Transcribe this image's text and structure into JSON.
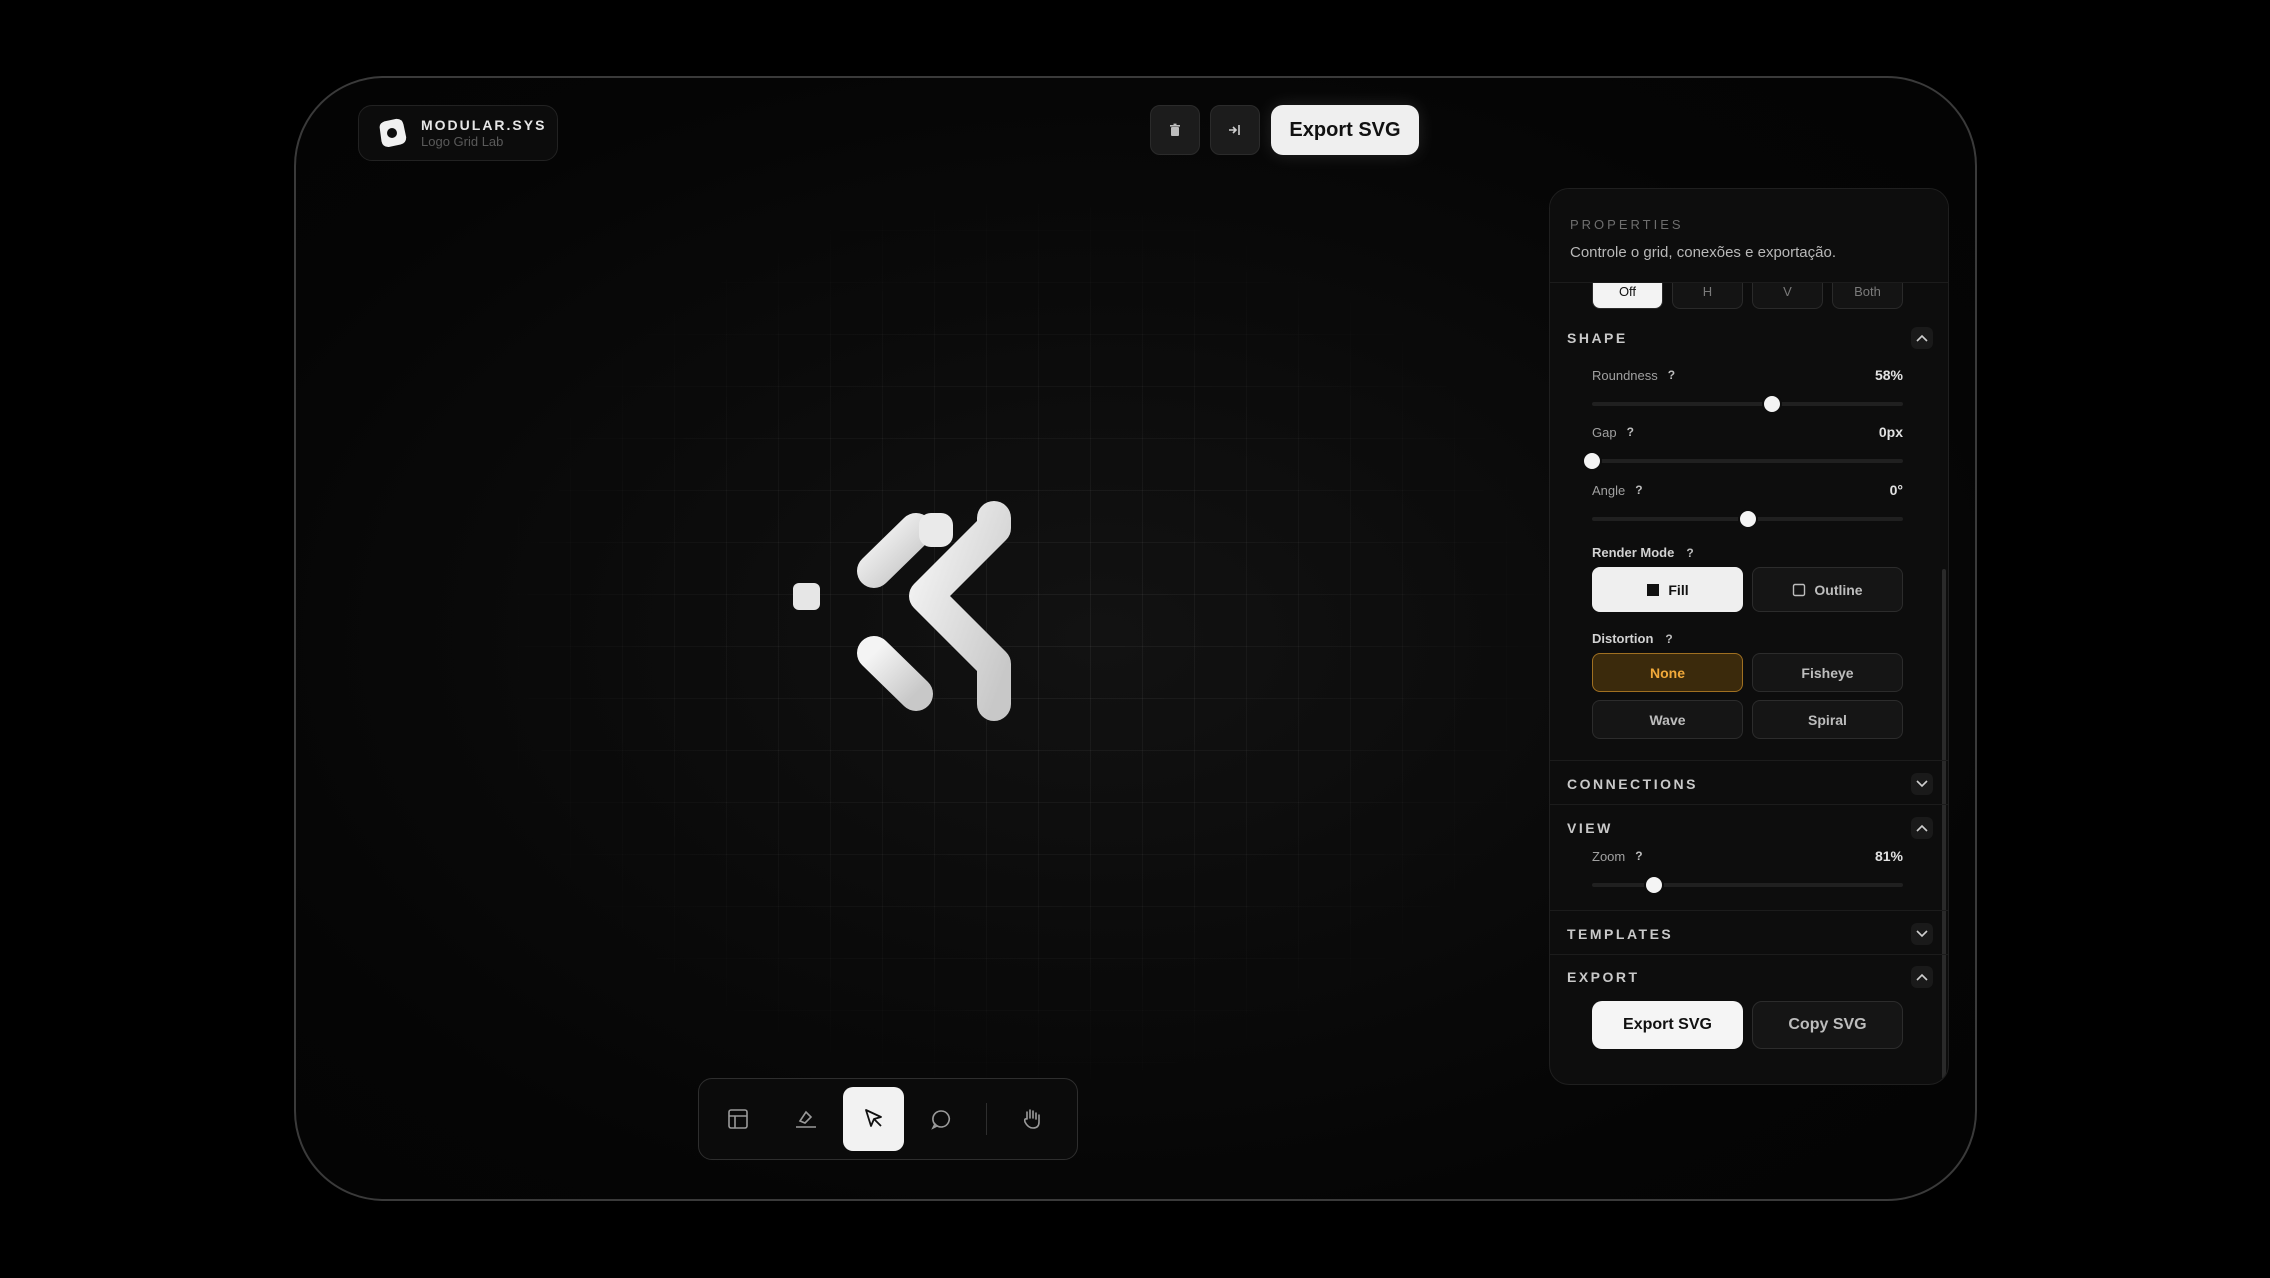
{
  "brand": {
    "title": "MODULAR.SYS",
    "subtitle": "Logo Grid Lab"
  },
  "toolbar": {
    "export_label": "Export SVG",
    "delete_icon": "trash-icon",
    "mirror_icon": "split-arrow-icon"
  },
  "dock": {
    "items": [
      "layout-icon",
      "stamp-icon",
      "cursor-icon",
      "comment-icon",
      "hand-icon"
    ],
    "active": "cursor-icon"
  },
  "panel": {
    "title": "PROPERTIES",
    "description": "Controle o grid, conexões e exportação.",
    "mirror": {
      "options": [
        "Off",
        "H",
        "V",
        "Both"
      ],
      "selected": "Off"
    },
    "shape": {
      "title": "SHAPE",
      "roundness": {
        "label": "Roundness",
        "help": "?",
        "value": "58%",
        "fraction": 0.58
      },
      "gap": {
        "label": "Gap",
        "help": "?",
        "value": "0px",
        "fraction": 0.0
      },
      "angle": {
        "label": "Angle",
        "help": "?",
        "value": "0°",
        "fraction": 0.5
      },
      "render_mode": {
        "label": "Render Mode",
        "help": "?",
        "fill": "Fill",
        "outline": "Outline",
        "selected": "Fill"
      },
      "distortion": {
        "label": "Distortion",
        "help": "?",
        "options": [
          "None",
          "Fisheye",
          "Wave",
          "Spiral"
        ],
        "selected": "None"
      }
    },
    "connections": {
      "title": "CONNECTIONS"
    },
    "view": {
      "title": "VIEW",
      "zoom": {
        "label": "Zoom",
        "help": "?",
        "value": "81%",
        "fraction": 0.2
      }
    },
    "templates": {
      "title": "TEMPLATES"
    },
    "export": {
      "title": "EXPORT",
      "export_label": "Export SVG",
      "copy_label": "Copy SVG"
    }
  },
  "colors": {
    "accent": "#f1a93a",
    "panel": "#0d0d0d",
    "logo": "#e4e4e4"
  }
}
